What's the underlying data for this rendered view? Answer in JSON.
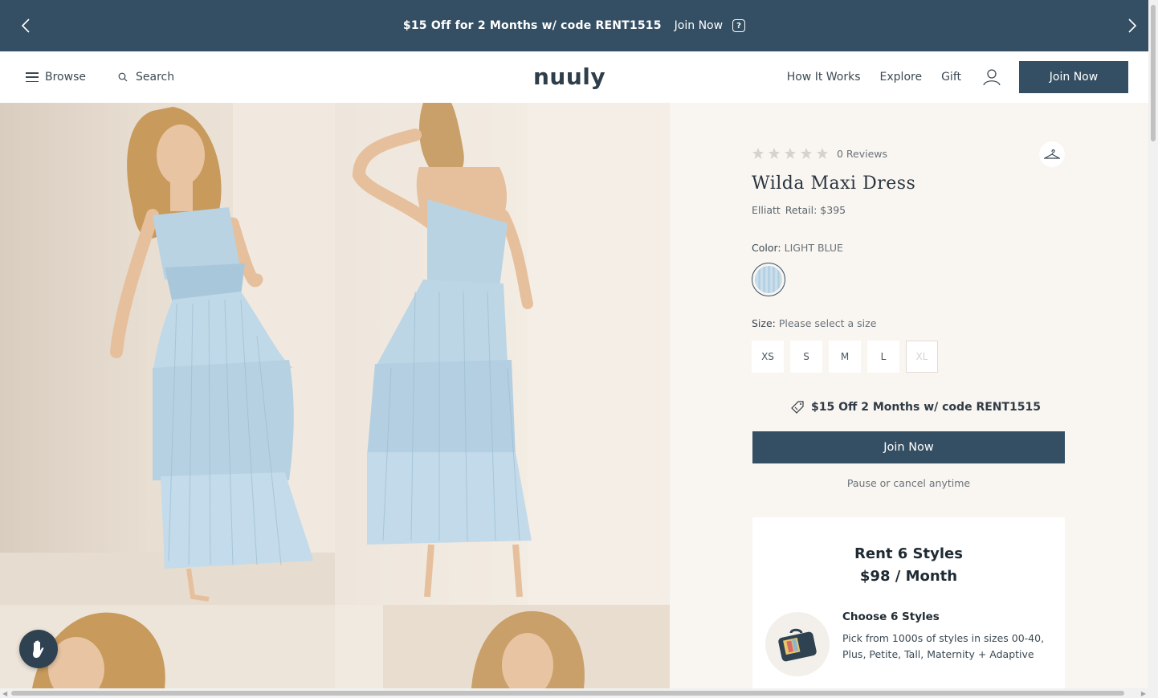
{
  "promo": {
    "message": "$15 Off for 2 Months w/ code RENT1515",
    "cta": "Join Now",
    "help_symbol": "?",
    "prev_icon": "chevron-left-icon",
    "next_icon": "chevron-right-icon"
  },
  "header": {
    "browse_label": "Browse",
    "search_label": "Search",
    "logo": "nuuly",
    "nav_links": [
      "How It Works",
      "Explore",
      "Gift"
    ],
    "join_label": "Join Now"
  },
  "product": {
    "reviews": "0 Reviews",
    "rating": 0,
    "stars_total": 5,
    "name": "Wilda Maxi Dress",
    "brand": "Elliatt",
    "retail": "Retail: $395",
    "color_label": "Color:",
    "color_value": "LIGHT BLUE",
    "size_label": "Size:",
    "size_value": "Please select a size",
    "sizes": [
      "XS",
      "S",
      "M",
      "L",
      "XL"
    ],
    "unavailable_sizes": [
      "XL"
    ],
    "promo_code_text": "$15 Off 2 Months w/ code RENT1515",
    "join_label": "Join Now",
    "pause_text": "Pause or cancel anytime"
  },
  "plan": {
    "title_line1": "Rent 6 Styles",
    "title_line2": "$98 / Month",
    "step_title": "Choose 6 Styles",
    "step_desc": "Pick from 1000s of styles in sizes 00-40, Plus, Petite, Tall, Maternity + Adaptive"
  },
  "colors": {
    "brand_dark": "#344f63",
    "panel_bg": "#f9f5f1",
    "dress_blue": "#bcd6e6"
  }
}
